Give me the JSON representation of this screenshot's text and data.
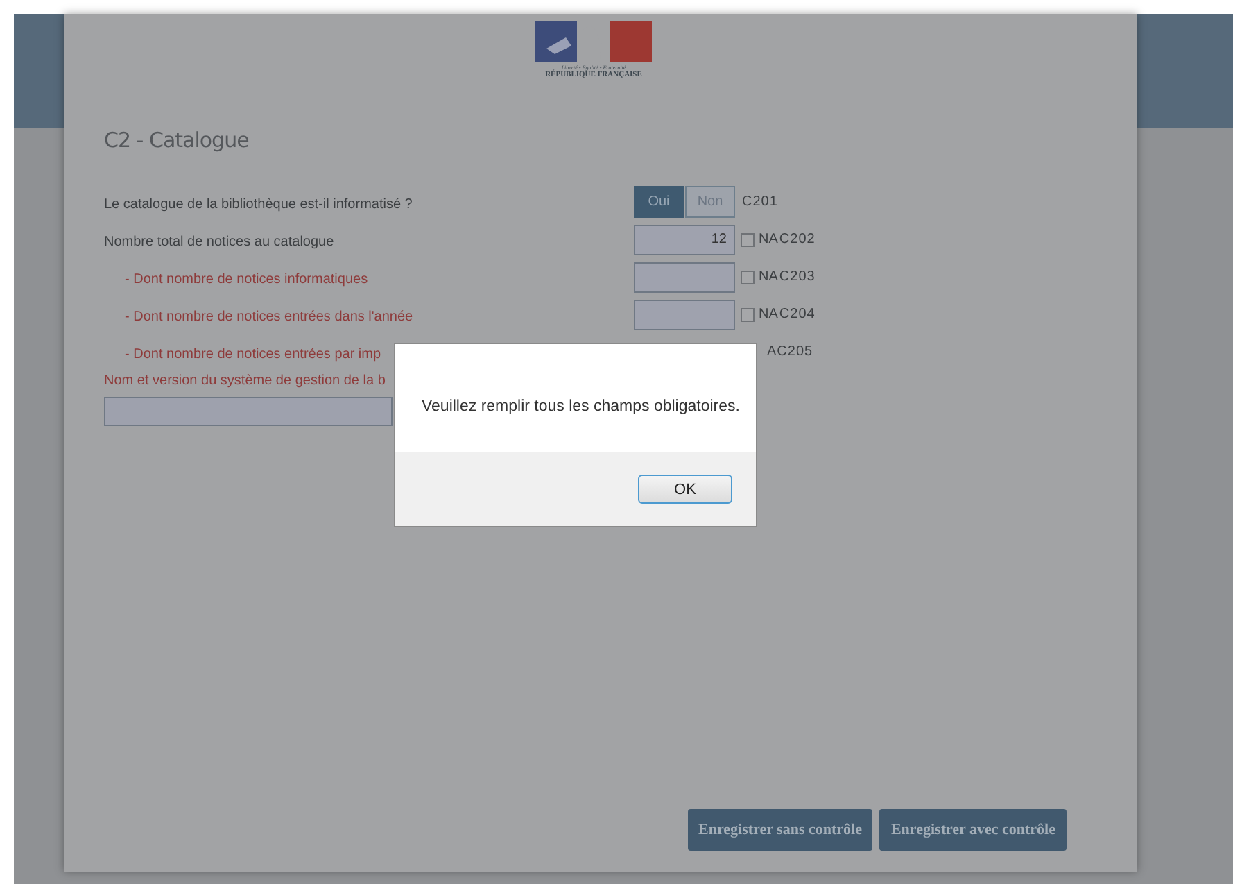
{
  "logo": {
    "motto": "Liberté • Égalité • Fraternité",
    "name": "RÉPUBLIQUE FRANÇAISE"
  },
  "section": {
    "title": "C2 - Catalogue"
  },
  "rows": [
    {
      "kind": "yesno",
      "label": "Le catalogue de la bibliothèque est-il informatisé ?",
      "required": false,
      "indent": false,
      "options": [
        {
          "label": "Oui",
          "selected": true
        },
        {
          "label": "Non",
          "selected": false
        }
      ],
      "code": "C201"
    },
    {
      "kind": "number",
      "label": "Nombre total de notices au catalogue",
      "required": false,
      "indent": false,
      "value": "12",
      "na_label": "NA",
      "na_checked": false,
      "code": "C202"
    },
    {
      "kind": "number",
      "label": "- Dont nombre de notices informatiques",
      "required": true,
      "indent": true,
      "na_label": "NA",
      "na_checked": false,
      "code": "C203"
    },
    {
      "kind": "number",
      "label": "- Dont nombre de notices entrées dans l'année",
      "required": true,
      "indent": true,
      "na_label": "NA",
      "na_checked": false,
      "code": "C204"
    },
    {
      "kind": "partial",
      "label": "- Dont nombre de notices entrées par imp",
      "required": true,
      "indent": true,
      "code": "AC205"
    }
  ],
  "text_field": {
    "label": "Nom et version du système de gestion de la b",
    "required": true
  },
  "buttons": [
    "Enregistrer sans contrôle",
    "Enregistrer avec contrôle"
  ],
  "dialog": {
    "message": "Veuillez remplir tous les champs obligatoires.",
    "button": "OK"
  }
}
